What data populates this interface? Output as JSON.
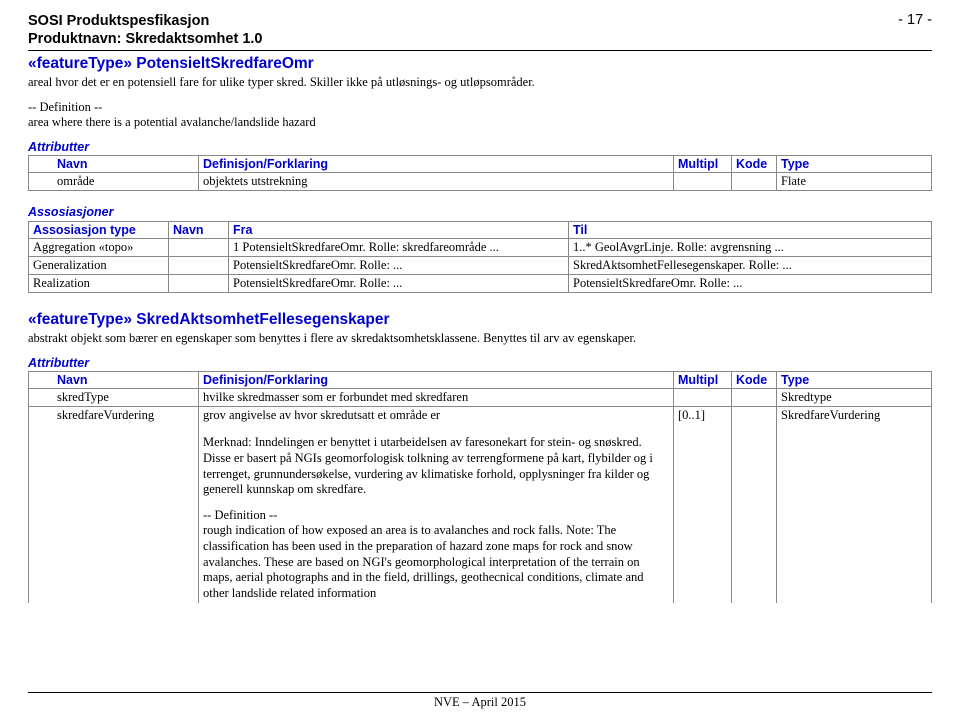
{
  "header": {
    "line1": "SOSI Produktspesfikasjon",
    "line2": "Produktnavn: Skredaktsomhet 1.0",
    "page": "- 17 -"
  },
  "feature1": {
    "title": "«featureType» PotensieltSkredfareOmr",
    "desc": "areal hvor det er en potensiell fare for ulike typer skred. Skiller ikke på utløsnings- og utløpsområder.",
    "definition": "-- Definition --\narea where there is a potential avalanche/landslide hazard"
  },
  "attr1": {
    "section": "Attributter",
    "headers": [
      "Navn",
      "Definisjon/Forklaring",
      "Multipl",
      "Kode",
      "Type"
    ],
    "rows": [
      {
        "navn": "område",
        "def": "objektets utstrekning",
        "mult": "",
        "kode": "",
        "type": "Flate"
      }
    ]
  },
  "assoc": {
    "section": "Assosiasjoner",
    "headers": [
      "Assosiasjon type",
      "Navn",
      "Fra",
      "Til"
    ],
    "rows": [
      {
        "type": "Aggregation «topo»",
        "navn": "",
        "fra": "1   PotensieltSkredfareOmr. Rolle: skredfareområde ...",
        "til": "1..*   GeolAvgrLinje. Rolle: avgrensning ..."
      },
      {
        "type": "Generalization",
        "navn": "",
        "fra": "PotensieltSkredfareOmr. Rolle: ...",
        "til": "SkredAktsomhetFellesegenskaper. Rolle: ..."
      },
      {
        "type": "Realization",
        "navn": "",
        "fra": "PotensieltSkredfareOmr. Rolle: ...",
        "til": "PotensieltSkredfareOmr. Rolle: ..."
      }
    ]
  },
  "feature2": {
    "title": "«featureType» SkredAktsomhetFellesegenskaper",
    "desc": "abstrakt objekt som bærer en egenskaper som benyttes i flere av skredaktsomhetsklassene. Benyttes til arv av egenskaper."
  },
  "attr2": {
    "section": "Attributter",
    "headers": [
      "Navn",
      "Definisjon/Forklaring",
      "Multipl",
      "Kode",
      "Type"
    ],
    "rows": [
      {
        "navn": "skredType",
        "def": "hvilke skredmasser som er forbundet med skredfaren",
        "mult": "",
        "kode": "",
        "type": "Skredtype"
      },
      {
        "navn": "skredfareVurdering",
        "def": "grov angivelse av hvor skredutsatt et område er",
        "mult": "[0..1]",
        "kode": "",
        "type": "SkredfareVurdering"
      }
    ],
    "note1": "Merknad: Inndelingen er benyttet i utarbeidelsen av faresonekart for stein- og snøskred. Disse er basert på NGIs geomorfologisk tolkning av terrengformene på kart, flybilder og i terrenget, grunnundersøkelse, vurdering av klimatiske forhold, opplysninger fra kilder og generell kunnskap om skredfare.",
    "note2": "-- Definition --\nrough indication of how exposed an area is to avalanches and rock falls. Note: The classification has been used in the preparation of hazard zone maps for rock and snow avalanches. These are based on NGI's geomorphological interpretation of the terrain on maps, aerial photographs and in the field, drillings, geothecnical conditions, climate and other landslide related information"
  },
  "footer": "NVE – April 2015"
}
